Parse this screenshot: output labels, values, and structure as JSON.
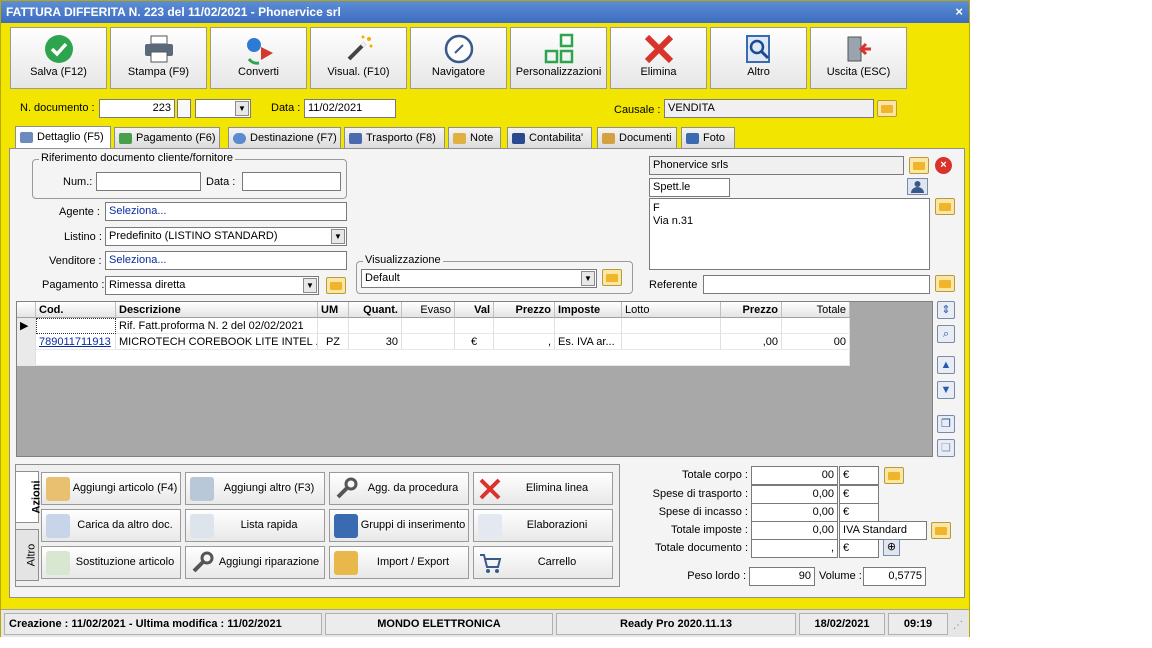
{
  "window": {
    "title": "FATTURA DIFFERITA N. 223 del 11/02/2021 - Phonervice srl",
    "close": "×"
  },
  "toolbar": [
    {
      "label": "Salva (F12)",
      "icon": "check-icon"
    },
    {
      "label": "Stampa (F9)",
      "icon": "printer-icon"
    },
    {
      "label": "Converti",
      "icon": "convert-icon"
    },
    {
      "label": "Visual. (F10)",
      "icon": "magic-wand-icon"
    },
    {
      "label": "Navigatore",
      "icon": "compass-icon"
    },
    {
      "label": "Personalizzazioni",
      "icon": "grid-icon"
    },
    {
      "label": "Elimina",
      "icon": "delete-x-icon"
    },
    {
      "label": "Altro",
      "icon": "magnifier-icon"
    },
    {
      "label": "Uscita (ESC)",
      "icon": "exit-door-icon"
    }
  ],
  "header": {
    "ndoc_label": "N. documento :",
    "ndoc_value": "223",
    "data_label": "Data :",
    "data_value": "11/02/2021",
    "causale_label": "Causale :",
    "causale_value": "VENDITA"
  },
  "tabs": [
    {
      "label": "Dettaglio (F5)",
      "active": true
    },
    {
      "label": "Pagamento (F6)"
    },
    {
      "label": "Destinazione (F7)"
    },
    {
      "label": "Trasporto (F8)"
    },
    {
      "label": "Note"
    },
    {
      "label": "Contabilita'"
    },
    {
      "label": "Documenti"
    },
    {
      "label": "Foto"
    }
  ],
  "dettaglio": {
    "rif_group": "Riferimento documento cliente/fornitore",
    "num_label": "Num.:",
    "num_value": "",
    "data_label": "Data :",
    "data_value": "",
    "agente_label": "Agente :",
    "agente_value": "Seleziona...",
    "listino_label": "Listino :",
    "listino_value": "Predefinito (LISTINO STANDARD)",
    "venditore_label": "Venditore :",
    "venditore_value": "Seleziona...",
    "pagamento_label": "Pagamento :",
    "pagamento_value": "Rimessa diretta",
    "visual_group": "Visualizzazione",
    "visual_value": "Default",
    "cliente_nome": "Phonervice srls",
    "cliente_saluto": "Spett.le",
    "indirizzo_line1": "F",
    "indirizzo_line2": "Via n.31",
    "referente_label": "Referente",
    "referente_value": ""
  },
  "grid": {
    "headers": [
      "Cod.",
      "Descrizione",
      "UM",
      "Quant.",
      "Evaso",
      "Val",
      "Prezzo",
      "Imposte",
      "Lotto",
      "Prezzo",
      "Totale"
    ],
    "rows": [
      {
        "cod": "",
        "descr": "Rif. Fatt.proforma N. 2 del 02/02/2021",
        "um": "",
        "quant": "",
        "evaso": "",
        "val": "",
        "prezzo": "",
        "imposte": "",
        "lotto": "",
        "prezzo2": "",
        "totale": ""
      },
      {
        "cod": "789011711913",
        "descr": "MICROTECH COREBOOK LITE INTEL ...",
        "um": "PZ",
        "quant": "30",
        "evaso": "",
        "val": "€",
        "prezzo": ",",
        "imposte": "Es. IVA ar...",
        "lotto": "",
        "prezzo2": ",00",
        "totale": "00"
      }
    ]
  },
  "actions": {
    "tab_azioni": "Azioni",
    "tab_altro": "Altro",
    "buttons": [
      "Aggiungi articolo (F4)",
      "Aggiungi altro (F3)",
      "Agg. da procedura",
      "Elimina linea",
      "Carica da altro doc.",
      "Lista rapida",
      "Gruppi di inserimento",
      "Elaborazioni",
      "Sostituzione articolo",
      "Aggiungi riparazione",
      "Import / Export",
      "Carrello"
    ]
  },
  "totals": {
    "corpo_label": "Totale corpo :",
    "corpo_value": "00",
    "trasporto_label": "Spese di trasporto :",
    "trasporto_value": "0,00",
    "incasso_label": "Spese di incasso :",
    "incasso_value": "0,00",
    "imposte_label": "Totale imposte :",
    "imposte_value": "0,00",
    "imposte_note": "IVA Standard",
    "documento_label": "Totale documento :",
    "documento_value": ",",
    "currency": "€",
    "peso_label": "Peso lordo :",
    "peso_value": "90",
    "volume_label": "Volume :",
    "volume_value": "0,5775"
  },
  "status": {
    "creazione": "Creazione : 11/02/2021 - Ultima modifica : 11/02/2021",
    "azienda": "MONDO ELETTRONICA",
    "versione": "Ready Pro 2020.11.13",
    "data": "18/02/2021",
    "ora": "09:19"
  },
  "colors": {
    "window_bg": "#f2e600",
    "titlebar": "#3c6cc0",
    "link": "#0a2aa0"
  }
}
